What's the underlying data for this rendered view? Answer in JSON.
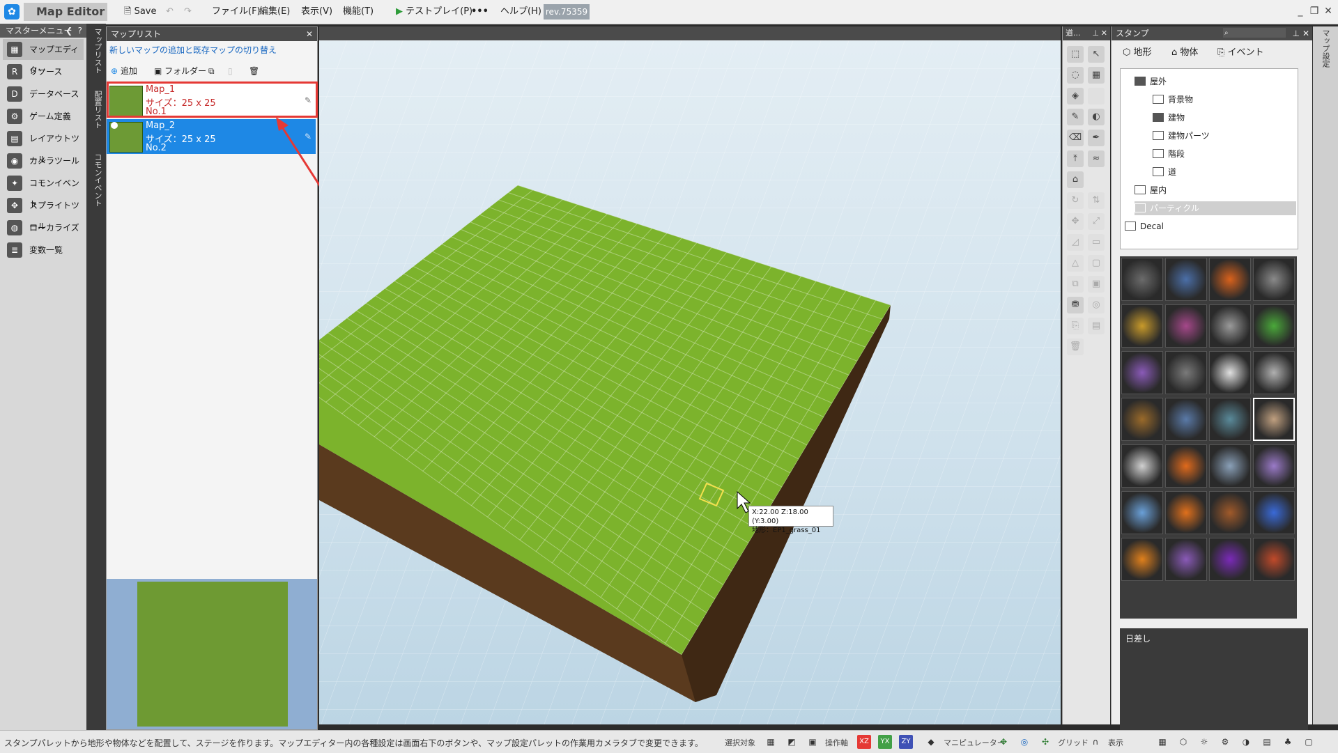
{
  "titlebar": {
    "app_title": "Map Editor",
    "save": "Save",
    "menus": [
      "ファイル(F)",
      "編集(E)",
      "表示(V)",
      "機能(T)"
    ],
    "test_play": "テストプレイ(P)",
    "more": "•••",
    "help": "ヘルプ(H)",
    "rev": "rev.75359"
  },
  "master_menu": {
    "title": "マスターメニュー",
    "items": [
      {
        "label": "マップエディター"
      },
      {
        "label": "リソース"
      },
      {
        "label": "データベース"
      },
      {
        "label": "ゲーム定義"
      },
      {
        "label": "レイアウトツール"
      },
      {
        "label": "カメラツール"
      },
      {
        "label": "コモンイベント"
      },
      {
        "label": "スプライトツール"
      },
      {
        "label": "ローカライズ"
      },
      {
        "label": "変数一覧"
      }
    ]
  },
  "vtabs": [
    "マップリスト",
    "配置リスト",
    "コモンイベント"
  ],
  "maplist": {
    "title": "マップリスト",
    "hint": "新しいマップの追加と既存マップの切り替え",
    "add": "追加",
    "folder": "フォルダー",
    "maps": [
      {
        "name": "Map_1",
        "size": "サイズ：25 x 25",
        "no": "No.1"
      },
      {
        "name": "Map_2",
        "size": "サイズ：25 x 25",
        "no": "No.2"
      }
    ]
  },
  "viewport": {
    "tooltip_line1": "X:22.00 Z:18.00 (Y:3.00)",
    "tooltip_line2": "地形：EP1_grass_01",
    "grass_color": "#7cb32c",
    "dirt_color": "#5a3a1e"
  },
  "toolbox": {
    "title": "道..."
  },
  "stamp": {
    "title": "スタンプ",
    "tabs": [
      "地形",
      "物体",
      "イベント"
    ],
    "tree": [
      {
        "label": "屋外",
        "level": 1
      },
      {
        "label": "背景物",
        "level": 2
      },
      {
        "label": "建物",
        "level": 2
      },
      {
        "label": "建物パーツ",
        "level": 2
      },
      {
        "label": "階段",
        "level": 2
      },
      {
        "label": "道",
        "level": 2
      },
      {
        "label": "屋内",
        "level": 1
      },
      {
        "label": "パーティクル",
        "level": 1
      },
      {
        "label": "Decal",
        "level": 0
      }
    ],
    "preview_label": "日差し"
  },
  "right_strip": "マップ設定",
  "statusbar": {
    "message": "スタンプパレットから地形や物体などを配置して、ステージを作ります。マップエディター内の各種設定は画面右下のボタンや、マップ設定パレットの作業用カメラタブで変更できます。",
    "select_target": "選択対象",
    "operation_axis": "操作軸",
    "manipulator": "マニピュレーター",
    "grid": "グリッド",
    "display": "表示",
    "axis_xz": "XZ",
    "axis_yx": "YX",
    "axis_zy": "ZY"
  }
}
